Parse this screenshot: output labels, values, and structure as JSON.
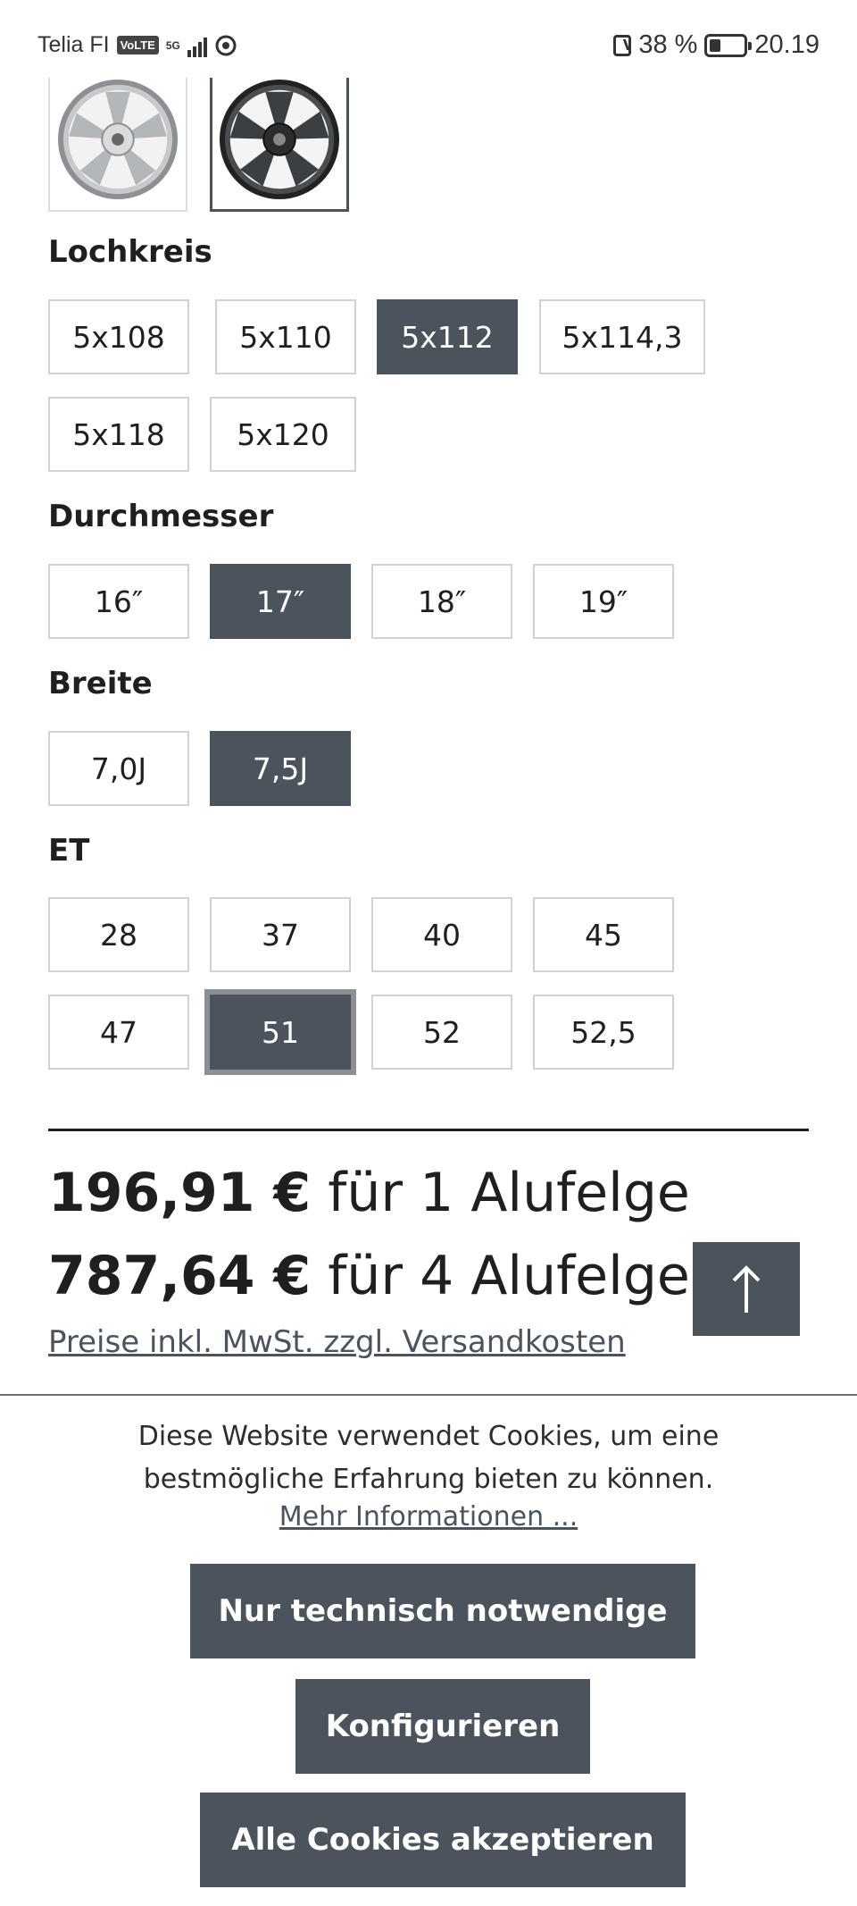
{
  "status_bar": {
    "carrier": "Telia FI",
    "volte_badge": "VoLTE",
    "network": "5G",
    "nfc_icon": "nfc-icon",
    "battery_percent": "38 %",
    "battery_level": 0.38,
    "time": "20.19"
  },
  "thumbnails": [
    {
      "name": "silver-wheel",
      "color": "#b9bbbd",
      "selected": false
    },
    {
      "name": "dark-wheel",
      "color": "#3c3f42",
      "selected": true
    }
  ],
  "lochkreis": {
    "label": "Lochkreis",
    "options": [
      "5x108",
      "5x110",
      "5x112",
      "5x114,3",
      "5x118",
      "5x120"
    ],
    "selected": "5x112"
  },
  "durchmesser": {
    "label": "Durchmesser",
    "options": [
      "16″",
      "17″",
      "18″",
      "19″"
    ],
    "selected": "17″"
  },
  "breite": {
    "label": "Breite",
    "options": [
      "7,0J",
      "7,5J"
    ],
    "selected": "7,5J"
  },
  "et": {
    "label": "ET",
    "options": [
      "28",
      "37",
      "40",
      "45",
      "47",
      "51",
      "52",
      "52,5"
    ],
    "selected": "51"
  },
  "price": {
    "single_amount": "196,91 €",
    "single_text": " für 1 Alufelge",
    "set_amount": "787,64 €",
    "set_text": " für 4 Alufelgen",
    "vat_link": "Preise inkl. MwSt. zzgl. Versandkosten"
  },
  "scroll_top_icon": "arrow-up-icon",
  "cookie": {
    "line1": "Diese Website verwendet Cookies, um eine",
    "line2": "bestmögliche Erfahrung bieten zu können.",
    "more_link": "Mehr Informationen ...",
    "btn_necessary": "Nur technisch notwendige",
    "btn_configure": "Konfigurieren",
    "btn_accept_all": "Alle Cookies akzeptieren"
  },
  "colors": {
    "accent": "#4b545c",
    "border": "#d2d2d2",
    "text": "#1f1f1f"
  }
}
